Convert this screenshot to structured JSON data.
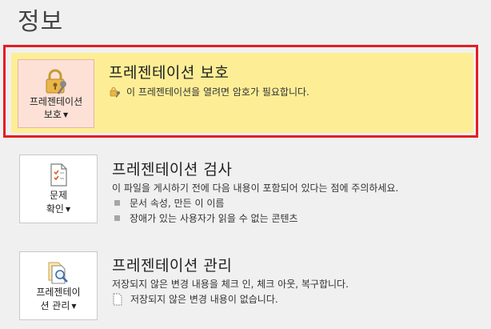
{
  "page": {
    "title": "정보"
  },
  "protect": {
    "button_line1": "프레젠테이션",
    "button_line2": "보호",
    "title": "프레젠테이션 보호",
    "desc": "이 프레젠테이션을 열려면 암호가 필요합니다.",
    "bg_color": "#fdee96",
    "frame_color": "#e31e24",
    "icon": "lock-key-icon"
  },
  "inspect": {
    "button_line1": "문제",
    "button_line2": "확인",
    "title": "프레젠테이션 검사",
    "desc": "이 파일을 게시하기 전에 다음 내용이 포함되어 있다는 점에 주의하세요.",
    "bullets": [
      "문서 속성, 만든 이 이름",
      "장애가 있는 사용자가 읽을 수 없는 콘텐츠"
    ],
    "icon": "inspect-document-icon"
  },
  "manage": {
    "button_line1": "프레젠테이",
    "button_line2": "션 관리",
    "title": "프레젠테이션 관리",
    "desc": "저장되지 않은 변경 내용을 체크 인, 체크 아웃, 복구합니다.",
    "sub": "저장되지 않은 변경 내용이 없습니다.",
    "icon": "manage-versions-icon"
  }
}
